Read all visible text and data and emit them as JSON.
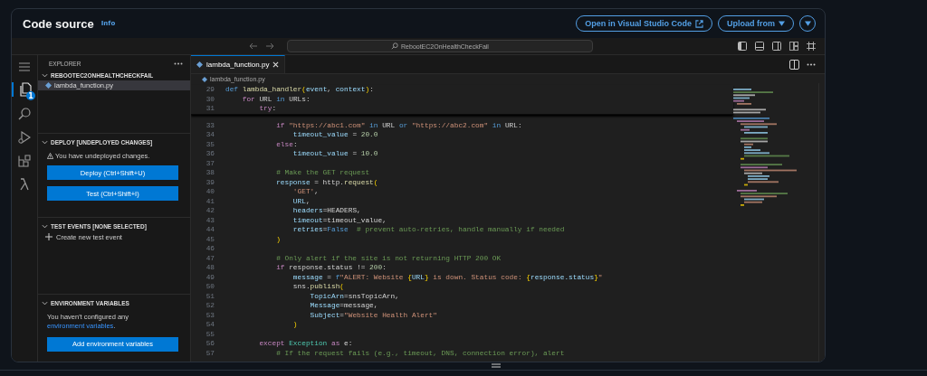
{
  "header": {
    "title": "Code source",
    "info_link": "Info",
    "buttons": [
      {
        "label": "Open in Visual Studio Code",
        "kind": "external"
      },
      {
        "label": "Upload from",
        "kind": "dropdown"
      }
    ]
  },
  "toolbar": {
    "search": "RebootEC2OnHealthCheckFail"
  },
  "activity_bar": {
    "files_badge": "1"
  },
  "explorer": {
    "title": "EXPLORER",
    "folder": {
      "name": "REBOOTEC2ONHEALTHCHECKFAIL",
      "expanded": true,
      "files": [
        {
          "name": "lambda_function.py",
          "selected": true
        }
      ]
    }
  },
  "deploy": {
    "title": "DEPLOY [UNDEPLOYED CHANGES]",
    "expanded": true,
    "warning": "You have undeployed changes.",
    "buttons": [
      "Deploy (Ctrl+Shift+U)",
      "Test (Ctrl+Shift+I)"
    ]
  },
  "test_events": {
    "title": "TEST EVENTS [NONE SELECTED]",
    "expanded": true,
    "action": "Create new test event"
  },
  "environment": {
    "title": "ENVIRONMENT VARIABLES",
    "expanded": true,
    "text": "You haven't configured any ",
    "link": "environment variables",
    "after": ".",
    "button": "Add environment variables"
  },
  "editor": {
    "tabs": [
      {
        "label": "lambda_function.py",
        "selected": true
      }
    ],
    "breadcrumb": "lambda_function.py",
    "sticky_lines": [
      {
        "number": "29",
        "tokens": [
          {
            "kind": "def",
            "text": "def "
          },
          {
            "kind": "fn",
            "text": "lambda_handler"
          },
          {
            "kind": "brace",
            "text": "("
          },
          {
            "kind": "var",
            "text": "event"
          },
          {
            "kind": "plain",
            "text": ", "
          },
          {
            "kind": "var",
            "text": "context"
          },
          {
            "kind": "brace",
            "text": ")"
          },
          {
            "kind": "plain",
            "text": ":"
          }
        ]
      },
      {
        "number": "30",
        "tokens": [
          {
            "kind": "kw",
            "text": "    for"
          },
          {
            "kind": "plain",
            "text": " URL "
          },
          {
            "kind": "def",
            "text": "in"
          },
          {
            "kind": "plain",
            "text": " URLs:"
          }
        ]
      },
      {
        "number": "31",
        "tokens": [
          {
            "kind": "kw",
            "text": "        try"
          },
          {
            "kind": "plain",
            "text": ":"
          }
        ]
      }
    ],
    "lines": [
      {
        "number": "33",
        "tokens": [
          {
            "kind": "kw",
            "text": "            if "
          },
          {
            "kind": "str",
            "text": "\"https://abc1.com\""
          },
          {
            "kind": "def",
            "text": " in"
          },
          {
            "kind": "plain",
            "text": " URL "
          },
          {
            "kind": "def",
            "text": "or "
          },
          {
            "kind": "str",
            "text": "\"https://abc2.com\""
          },
          {
            "kind": "def",
            "text": " in"
          },
          {
            "kind": "plain",
            "text": " URL:"
          }
        ]
      },
      {
        "number": "34",
        "tokens": [
          {
            "kind": "var",
            "text": "                timeout_value"
          },
          {
            "kind": "plain",
            "text": " = "
          },
          {
            "kind": "num",
            "text": "20.0"
          }
        ]
      },
      {
        "number": "35",
        "tokens": [
          {
            "kind": "kw",
            "text": "            else"
          },
          {
            "kind": "plain",
            "text": ":"
          }
        ]
      },
      {
        "number": "36",
        "tokens": [
          {
            "kind": "var",
            "text": "                timeout_value"
          },
          {
            "kind": "plain",
            "text": " = "
          },
          {
            "kind": "num",
            "text": "10.0"
          }
        ]
      },
      {
        "number": "37"
      },
      {
        "number": "38",
        "tokens": [
          {
            "kind": "com",
            "text": "            # Make the GET request"
          }
        ]
      },
      {
        "number": "39",
        "tokens": [
          {
            "kind": "var",
            "text": "            response"
          },
          {
            "kind": "plain",
            "text": " = http."
          },
          {
            "kind": "fn",
            "text": "request"
          },
          {
            "kind": "brace",
            "text": "("
          }
        ]
      },
      {
        "number": "40",
        "tokens": [
          {
            "kind": "str",
            "text": "                'GET'"
          },
          {
            "kind": "plain",
            "text": ","
          }
        ]
      },
      {
        "number": "41",
        "tokens": [
          {
            "kind": "var",
            "text": "                URL"
          },
          {
            "kind": "plain",
            "text": ","
          }
        ]
      },
      {
        "number": "42",
        "tokens": [
          {
            "kind": "var",
            "text": "                headers"
          },
          {
            "kind": "plain",
            "text": "=HEADERS,"
          }
        ]
      },
      {
        "number": "43",
        "tokens": [
          {
            "kind": "var",
            "text": "                timeout"
          },
          {
            "kind": "plain",
            "text": "=timeout_value,"
          }
        ]
      },
      {
        "number": "44",
        "tokens": [
          {
            "kind": "var",
            "text": "                retries"
          },
          {
            "kind": "plain",
            "text": "="
          },
          {
            "kind": "def",
            "text": "False"
          },
          {
            "kind": "com",
            "text": "  # prevent auto-retries, handle manually if needed"
          }
        ]
      },
      {
        "number": "45",
        "tokens": [
          {
            "kind": "brace",
            "text": "            )"
          }
        ]
      },
      {
        "number": "46"
      },
      {
        "number": "47",
        "tokens": [
          {
            "kind": "com",
            "text": "            # Only alert if the site is not returning HTTP 200 OK"
          }
        ]
      },
      {
        "number": "48",
        "tokens": [
          {
            "kind": "kw",
            "text": "            if"
          },
          {
            "kind": "plain",
            "text": " response.status != "
          },
          {
            "kind": "num",
            "text": "200"
          },
          {
            "kind": "plain",
            "text": ":"
          }
        ]
      },
      {
        "number": "49",
        "tokens": [
          {
            "kind": "var",
            "text": "                message"
          },
          {
            "kind": "plain",
            "text": " = "
          },
          {
            "kind": "def",
            "text": "f"
          },
          {
            "kind": "str",
            "text": "\"ALERT: Website "
          },
          {
            "kind": "brace",
            "text": "{"
          },
          {
            "kind": "var",
            "text": "URL"
          },
          {
            "kind": "brace",
            "text": "}"
          },
          {
            "kind": "str",
            "text": " is down. Status code: "
          },
          {
            "kind": "brace",
            "text": "{"
          },
          {
            "kind": "var",
            "text": "response.status"
          },
          {
            "kind": "brace",
            "text": "}"
          },
          {
            "kind": "str",
            "text": "\""
          }
        ]
      },
      {
        "number": "50",
        "tokens": [
          {
            "kind": "plain",
            "text": "                sns."
          },
          {
            "kind": "fn",
            "text": "publish"
          },
          {
            "kind": "brace",
            "text": "("
          }
        ]
      },
      {
        "number": "51",
        "tokens": [
          {
            "kind": "var",
            "text": "                    TopicArn"
          },
          {
            "kind": "plain",
            "text": "=snsTopicArn,"
          }
        ]
      },
      {
        "number": "52",
        "tokens": [
          {
            "kind": "var",
            "text": "                    Message"
          },
          {
            "kind": "plain",
            "text": "=message,"
          }
        ]
      },
      {
        "number": "53",
        "tokens": [
          {
            "kind": "var",
            "text": "                    Subject"
          },
          {
            "kind": "plain",
            "text": "="
          },
          {
            "kind": "str",
            "text": "\"Website Health Alert\""
          }
        ]
      },
      {
        "number": "54",
        "tokens": [
          {
            "kind": "brace",
            "text": "                )"
          }
        ]
      },
      {
        "number": "55"
      },
      {
        "number": "56",
        "tokens": [
          {
            "kind": "kw",
            "text": "        except "
          },
          {
            "kind": "cls",
            "text": "Exception"
          },
          {
            "kind": "kw",
            "text": " as"
          },
          {
            "kind": "plain",
            "text": " e:"
          }
        ]
      },
      {
        "number": "57",
        "tokens": [
          {
            "kind": "com",
            "text": "            # If the request fails (e.g., timeout, DNS, connection error), alert"
          }
        ]
      }
    ]
  }
}
